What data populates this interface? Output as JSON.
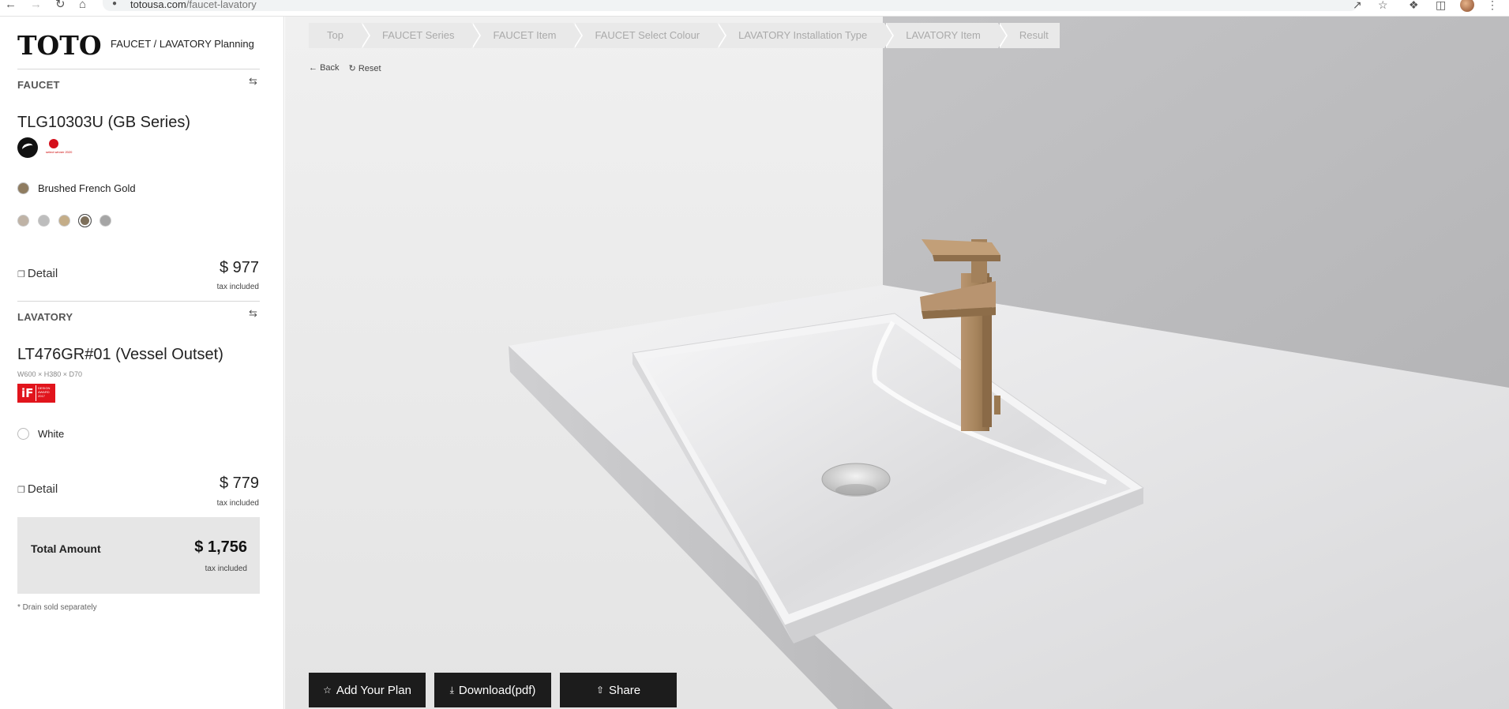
{
  "browser": {
    "host": "totousa.com",
    "path": "/faucet-lavatory"
  },
  "sidebar": {
    "logo": "TOTO",
    "title": "FAUCET / LAVATORY Planning",
    "faucet": {
      "section_label": "FAUCET",
      "product_name": "TLG10303U (GB Series)",
      "award_text": "select winner 2020",
      "color_name": "Brushed French Gold",
      "color_hex": "#8f7c60",
      "swatches": [
        "#bfb3a6",
        "#bdbdbd",
        "#c4ad88",
        "#7d6f5a",
        "#a5a5a5"
      ],
      "selected_swatch": 3,
      "detail_label": "Detail",
      "price": "$ 977",
      "tax_note": "tax included"
    },
    "lavatory": {
      "section_label": "LAVATORY",
      "product_name": "LT476GR#01 (Vessel Outset)",
      "dimensions": "W600 × H380 × D70",
      "award_badge": "iF",
      "award_text": "DESIGN AWARD 2017",
      "color_name": "White",
      "color_hex": "#ffffff",
      "detail_label": "Detail",
      "price": "$ 779",
      "tax_note": "tax included"
    },
    "total": {
      "label": "Total Amount",
      "amount": "$ 1,756",
      "tax_note": "tax included"
    },
    "note": "* Drain sold separately"
  },
  "viewer": {
    "breadcrumbs": [
      "Top",
      "FAUCET Series",
      "FAUCET Item",
      "FAUCET Select Colour",
      "LAVATORY Installation Type",
      "LAVATORY Item",
      "Result"
    ],
    "back_label": "Back",
    "reset_label": "Reset",
    "actions": {
      "add_plan": "Add Your Plan",
      "download": "Download(pdf)",
      "share": "Share"
    }
  },
  "colors": {
    "button_bg": "#1c1c1c",
    "faucet_gold": "#a8865e",
    "wall": "#bfbfc1",
    "floor": "#ececec"
  }
}
